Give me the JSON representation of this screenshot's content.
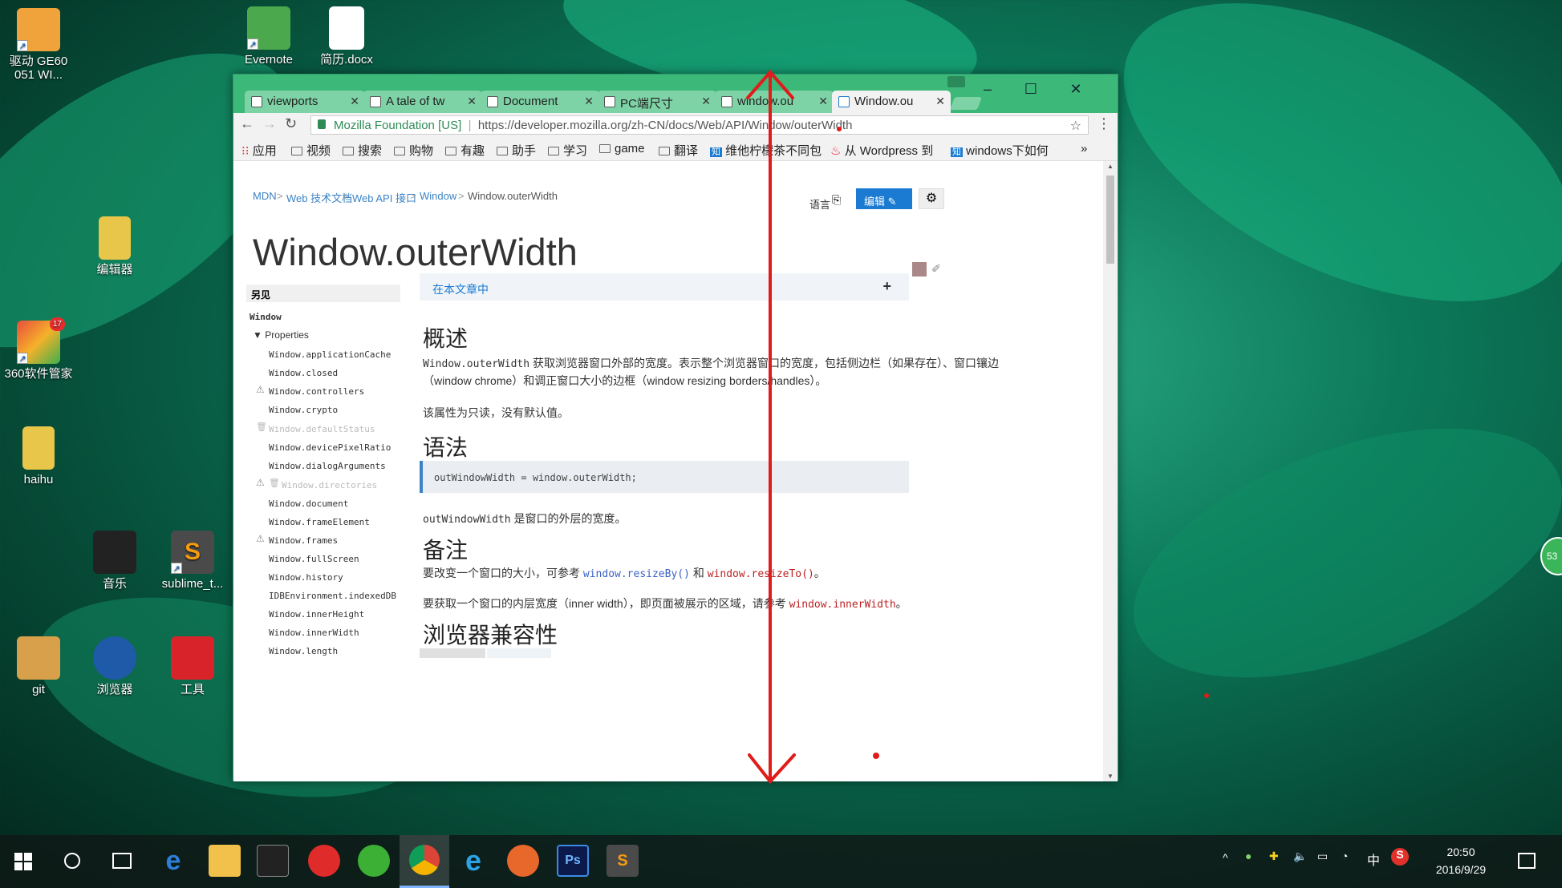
{
  "desktop": {
    "icons": [
      {
        "label": "驱动 GE60\n051 WI...",
        "color": "#f0a33a"
      },
      {
        "label": "Evernote",
        "color": "#4ca84c"
      },
      {
        "label": "简历.docx",
        "color": "#ffffff"
      },
      {
        "label": "编辑器",
        "color": "#e8c64a"
      },
      {
        "label": "360软件管家",
        "color": "#e84c3d"
      },
      {
        "label": "haihu",
        "color": "#e8c64a"
      },
      {
        "label": "音乐",
        "color": "#222222"
      },
      {
        "label": "sublime_t...",
        "color": "#555555"
      },
      {
        "label": "git",
        "color": "#d9a04b"
      },
      {
        "label": "浏览器",
        "color": "#1e5aa8"
      },
      {
        "label": "工具",
        "color": "#d8232a"
      }
    ],
    "badge_count": "17",
    "side_bubble": "53"
  },
  "browser": {
    "tabs": [
      {
        "label": "viewports",
        "active": false
      },
      {
        "label": "A tale of tw",
        "active": false
      },
      {
        "label": "Document",
        "active": false
      },
      {
        "label": "PC端尺寸",
        "active": false
      },
      {
        "label": "window.ou",
        "active": false
      },
      {
        "label": "Window.ou",
        "active": true
      }
    ],
    "address": {
      "security_label": "Mozilla Foundation [US]",
      "url": "https://developer.mozilla.org/zh-CN/docs/Web/API/Window/outerWidth"
    },
    "bookmarks": [
      "应用",
      "视频",
      "搜索",
      "购物",
      "有趣",
      "助手",
      "学习",
      "game",
      "翻译",
      "维他柠檬茶不同包",
      "从 Wordpress 到",
      "windows下如何"
    ],
    "bookmarks_more": "»"
  },
  "mdn": {
    "breadcrumb": [
      "MDN",
      "Web 技术文档",
      "Web API 接口",
      "Window",
      "Window.outerWidth"
    ],
    "language_label": "语言",
    "edit_label": "编辑",
    "title": "Window.outerWidth",
    "sidebar": {
      "heading": "另见",
      "root": "Window",
      "section": "Properties",
      "items": [
        "Window.applicationCache",
        "Window.closed",
        "Window.controllers",
        "Window.crypto",
        "Window.defaultStatus",
        "Window.devicePixelRatio",
        "Window.dialogArguments",
        "Window.directories",
        "Window.document",
        "Window.frameElement",
        "Window.frames",
        "Window.fullScreen",
        "Window.history",
        "IDBEnvironment.indexedDB",
        "Window.innerHeight",
        "Window.innerWidth",
        "Window.length"
      ]
    },
    "toc_label": "在本文章中",
    "toc_plus": "+",
    "sections": {
      "overview_title": "概述",
      "overview_code": "Window.outerWidth",
      "overview_text1": " 获取浏览器窗口外部的宽度。表示整个浏览器窗口的宽度，包括侧边栏（如果存在）、窗口镶边",
      "overview_text2": "（window chrome）和调正窗口大小的边框（window resizing borders/handles）。",
      "readonly_text": "该属性为只读，没有默认值。",
      "syntax_title": "语法",
      "syntax_code": "outWindowWidth = window.outerWidth;",
      "syntax_var": "outWindowWidth",
      "syntax_desc": " 是窗口的外层的宽度。",
      "notes_title": "备注",
      "notes_text1": "要改变一个窗口的大小，可参考 ",
      "notes_link1": "window.resizeBy()",
      "notes_and": " 和 ",
      "notes_link2": "window.resizeTo()",
      "notes_end": "。",
      "notes_text2": "要获取一个窗口的内层宽度（inner width），即页面被展示的区域，请参考 ",
      "notes_link3": "window.innerWidth",
      "compat_title": "浏览器兼容性"
    }
  },
  "taskbar": {
    "time": "20:50",
    "date": "2016/9/29",
    "ime": "中"
  },
  "colors": {
    "tab_bar": "#3cb878",
    "annotation_red": "#e01b1b",
    "mdn_link": "#3b83c4",
    "edit_button": "#1b7ad1"
  }
}
